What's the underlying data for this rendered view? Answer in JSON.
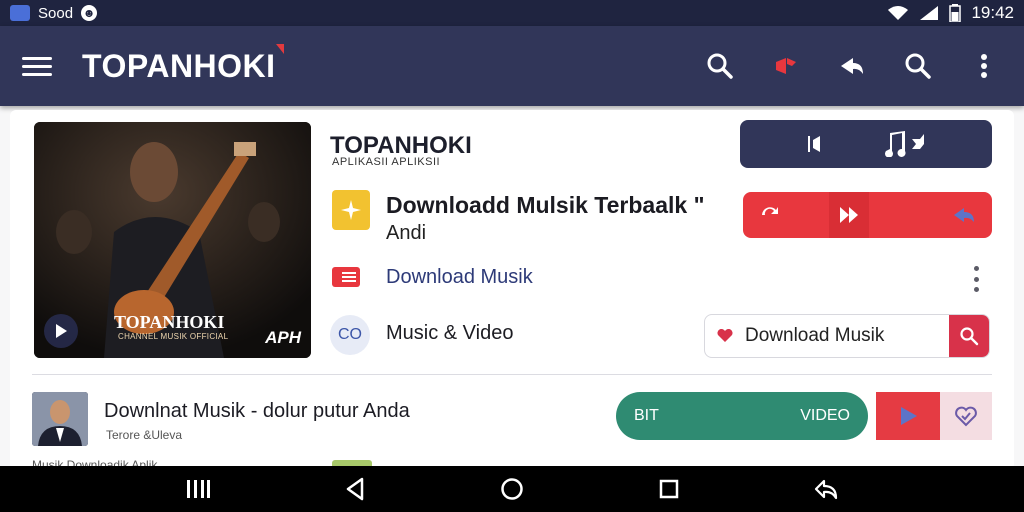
{
  "statusbar": {
    "app_label": "Sood",
    "time": "19:42"
  },
  "appbar": {
    "brand": "TOPANHOKI"
  },
  "featured": {
    "thumb_title": "TOPANHOKI",
    "thumb_sub": "CHANNEL MUSIK OFFICIAL",
    "thumb_badge": "APH",
    "app_name": "TOPANHOKI",
    "app_sub": "APLIKASII APLIKSII",
    "title": "Downloadd Mulsik Terbaalk \"",
    "author": "Andi",
    "link": "Download Musik",
    "circle_label": "CO",
    "media_label": "Music & Video",
    "search_label": "Download Musik"
  },
  "row2": {
    "title": "Downlnat Musik - dolur putur Anda",
    "sub": "Terore &Uleva",
    "pill_left": "BIT",
    "pill_right": "VIDEO",
    "peek": "Musik Downloadik Aplik"
  },
  "colors": {
    "appbar": "#313659",
    "accent_red": "#e8373e",
    "accent_green": "#2f8b72"
  }
}
